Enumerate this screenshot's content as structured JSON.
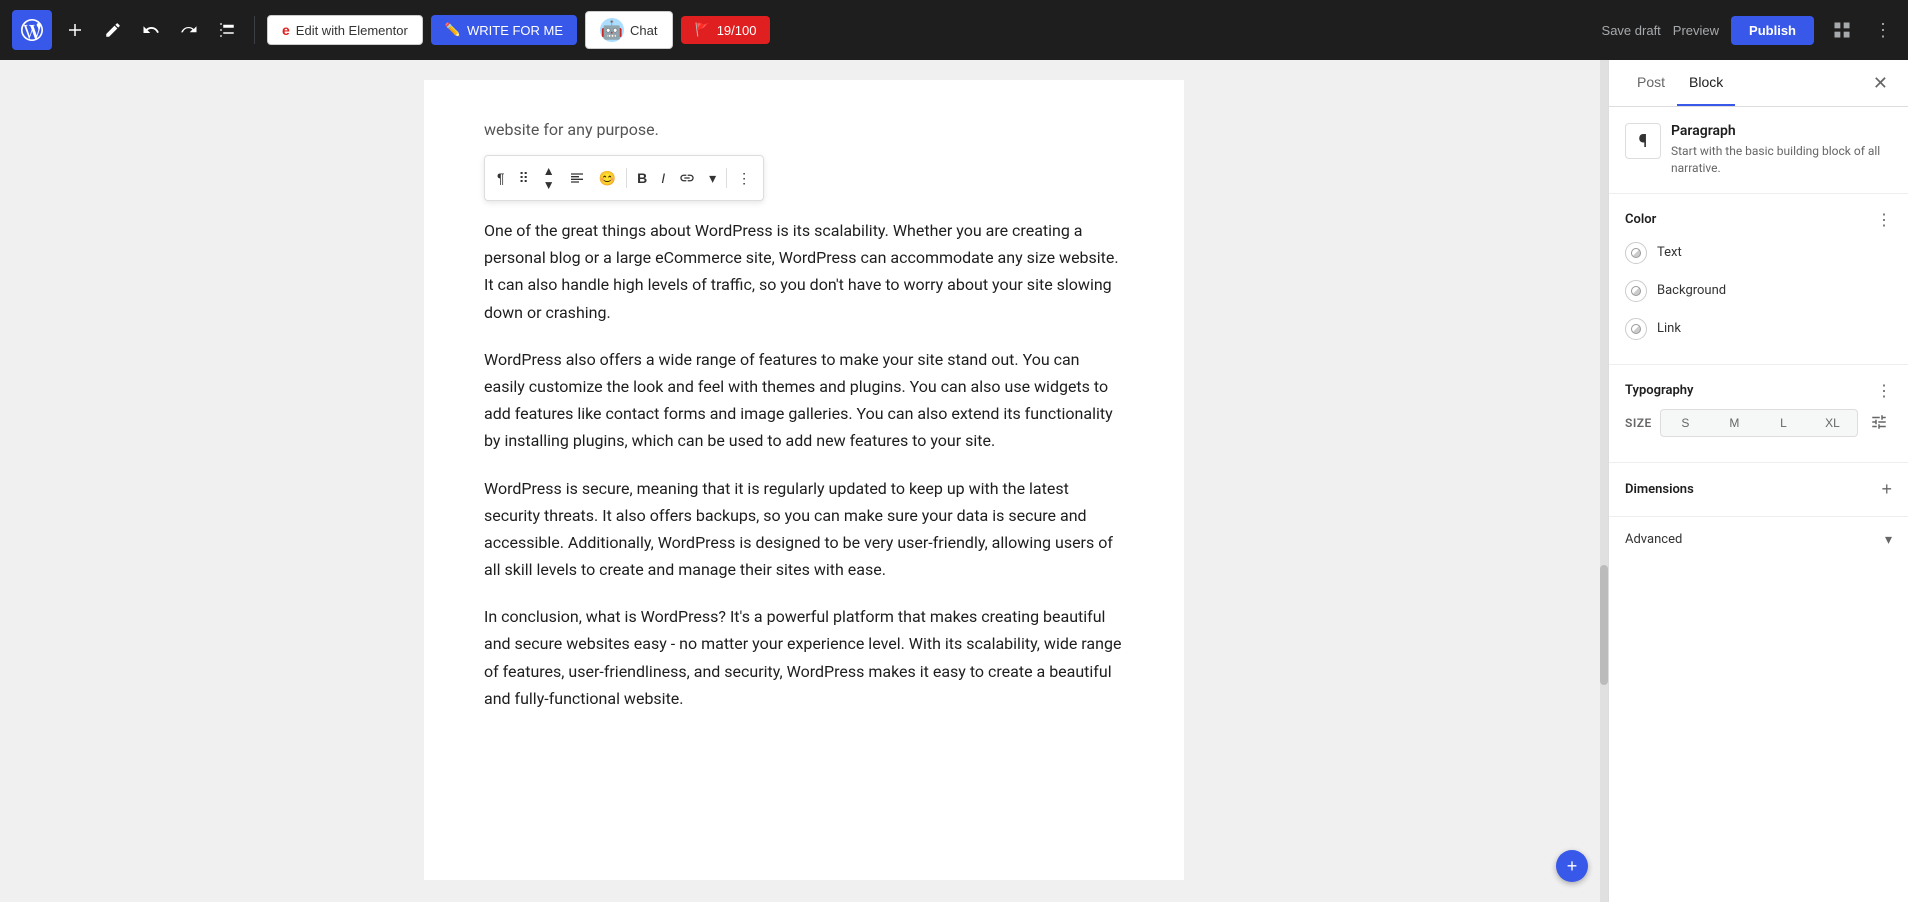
{
  "topbar": {
    "wp_logo_alt": "WordPress",
    "btn_add": "+",
    "btn_edit_elementor": "Edit with Elementor",
    "btn_write_for_me": "WRITE FOR ME",
    "btn_chat": "Chat",
    "btn_counter": "19/100",
    "btn_save_draft": "Save draft",
    "btn_preview": "Preview",
    "btn_publish": "Publish"
  },
  "editor": {
    "cropped_text": "website for any purpose.",
    "paragraph1": "One of the great things about WordPress is its scalability. Whether you are creating a personal blog or a large eCommerce site, WordPress can accommodate any size website. It can also handle high levels of traffic, so you don't have to worry about your site slowing down or crashing.",
    "paragraph2": "WordPress also offers a wide range of features to make your site stand out. You can easily customize the look and feel with themes and plugins. You can also use widgets to add features like contact forms and image galleries. You can also extend its functionality by installing plugins, which can be used to add new features to your site.",
    "paragraph3": "WordPress is secure, meaning that it is regularly updated to keep up with the latest security threats. It also offers backups, so you can make sure your data is secure and accessible. Additionally, WordPress is designed to be very user-friendly, allowing users of all skill levels to create and manage their sites with ease.",
    "paragraph4": "In conclusion, what is WordPress? It's a powerful platform that makes creating beautiful and secure websites easy - no matter your experience level. With its scalability, wide range of features, user-friendliness, and security, WordPress makes it easy to create a beautiful and fully-functional website."
  },
  "sidebar": {
    "tab_post": "Post",
    "tab_block": "Block",
    "block_title": "Paragraph",
    "block_description": "Start with the basic building block of all narrative.",
    "color_section_title": "Color",
    "color_text_label": "Text",
    "color_background_label": "Background",
    "color_link_label": "Link",
    "typography_section_title": "Typography",
    "size_label": "SIZE",
    "size_s": "S",
    "size_m": "M",
    "size_l": "L",
    "size_xl": "XL",
    "dimensions_label": "Dimensions",
    "advanced_label": "Advanced"
  },
  "toolbar": {
    "paragraph_icon": "¶",
    "drag_icon": "⠿",
    "move_up_down": "↕",
    "align_center": "≡",
    "emoji": "😊",
    "bold": "B",
    "italic": "I",
    "link": "🔗",
    "chevron": "▾",
    "more": "⋮"
  }
}
